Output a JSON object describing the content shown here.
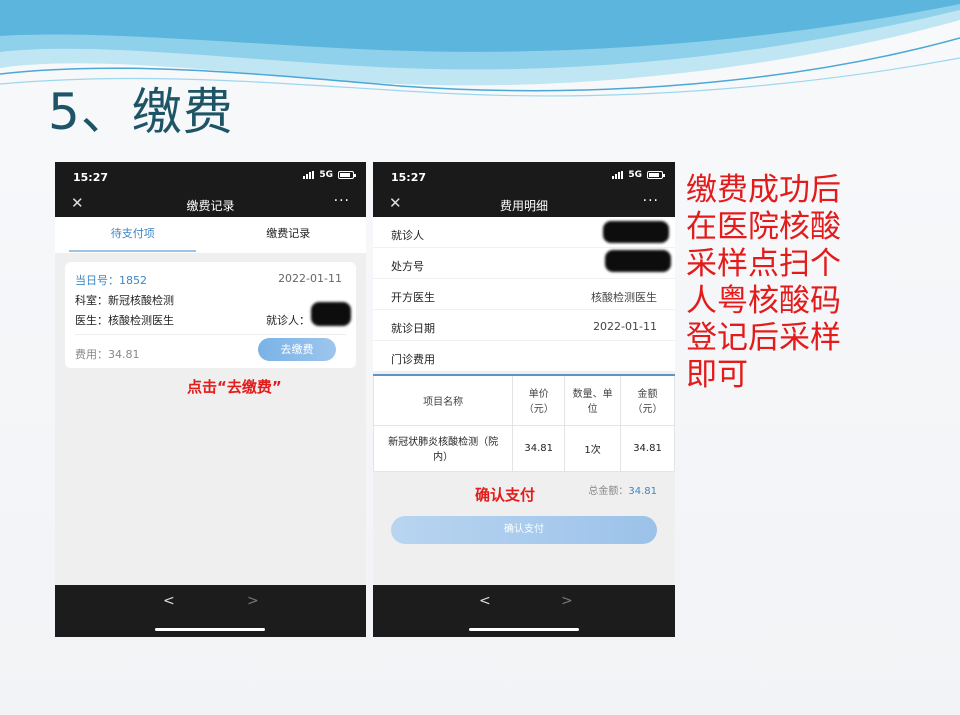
{
  "slide": {
    "title": "5、缴费",
    "note_lines": [
      "缴费成功后",
      "在医院核酸",
      "采样点扫个",
      "人粤核酸码",
      "登记后采样",
      "即可"
    ]
  },
  "phone1": {
    "status": {
      "time": "15:27",
      "network": "5G"
    },
    "nav": {
      "title": "缴费记录",
      "close_glyph": "✕",
      "more_glyph": "···"
    },
    "tabs": [
      {
        "label": "待支付项",
        "active": true
      },
      {
        "label": "缴费记录",
        "active": false
      }
    ],
    "card": {
      "number": "当日号：1852",
      "date": "2022-01-11",
      "department": "科室：新冠核酸检测",
      "doctor": "医生：核酸检测医生",
      "patient_label": "就诊人：",
      "fee": "费用：34.81",
      "pay_button": "去缴费"
    },
    "annotation": "点击“去缴费”",
    "bottom": {
      "back": "<",
      "forward": ">"
    }
  },
  "phone2": {
    "status": {
      "time": "15:27",
      "network": "5G"
    },
    "nav": {
      "title": "费用明细",
      "close_glyph": "✕",
      "more_glyph": "···"
    },
    "info_rows": [
      {
        "label": "就诊人",
        "value": ""
      },
      {
        "label": "处方号",
        "value": ""
      },
      {
        "label": "开方医生",
        "value": "核酸检测医生"
      },
      {
        "label": "就诊日期",
        "value": "2022-01-11"
      },
      {
        "label": "门诊费用",
        "value": ""
      }
    ],
    "table": {
      "headers": [
        "项目名称",
        "单价（元）",
        "数量、单位",
        "金额（元）"
      ],
      "rows": [
        [
          "新冠状肺炎核酸检测（院内）",
          "34.81",
          "1次",
          "34.81"
        ]
      ]
    },
    "total_label": "总金额：",
    "total_value": "34.81",
    "annotation": "确认支付",
    "confirm_button": "确认支付",
    "bottom": {
      "back": "<",
      "forward": ">"
    }
  },
  "colors": {
    "accent": "#3d86c6",
    "annotation": "#e31b1b",
    "title": "#1e5566"
  }
}
